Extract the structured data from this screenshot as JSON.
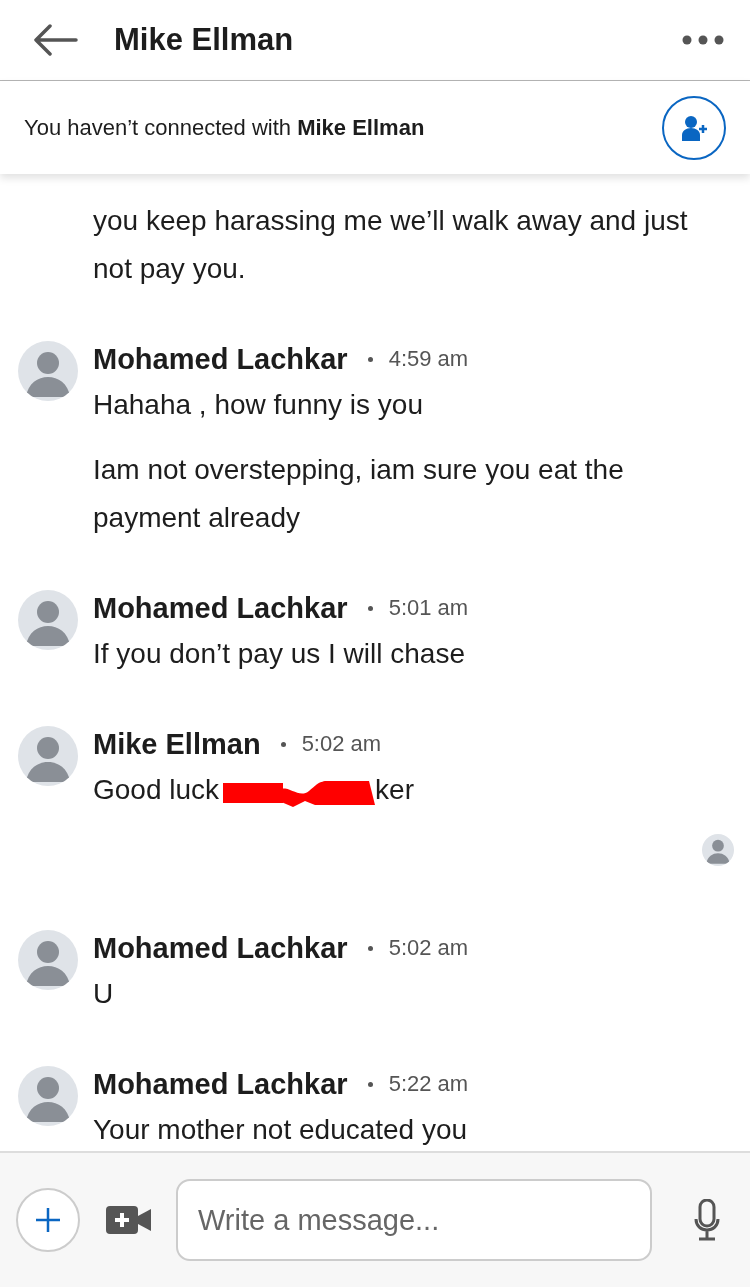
{
  "header": {
    "title": "Mike Ellman"
  },
  "connect_banner": {
    "text": "You haven’t connected with **Mike Ellman**"
  },
  "messages": [
    {
      "paragraphs": [
        [
          {
            "kind": "text",
            "text": "you keep harassing me we’ll walk away and just not pay you."
          }
        ]
      ]
    },
    {
      "sender": "Mohamed Lachkar",
      "time": "4:59 am",
      "paragraphs": [
        [
          {
            "kind": "text",
            "text": "Hahaha , how funny is you"
          }
        ],
        [
          {
            "kind": "text",
            "text": "Iam not overstepping, iam sure you eat the payment already"
          }
        ]
      ]
    },
    {
      "sender": "Mohamed Lachkar",
      "time": "5:01 am",
      "paragraphs": [
        [
          {
            "kind": "text",
            "text": "If you don’t  pay us I will chase"
          }
        ]
      ]
    },
    {
      "sender": "Mike Ellman",
      "time": "5:02 am",
      "seen": true,
      "paragraphs": [
        [
          {
            "kind": "text",
            "text": "Good luck"
          },
          {
            "kind": "redaction"
          },
          {
            "kind": "text",
            "text": "ker"
          }
        ]
      ]
    },
    {
      "sender": "Mohamed Lachkar",
      "time": "5:02 am",
      "paragraphs": [
        [
          {
            "kind": "text",
            "text": "U"
          }
        ]
      ]
    },
    {
      "sender": "Mohamed Lachkar",
      "time": "5:22 am",
      "paragraphs": [
        [
          {
            "kind": "text",
            "text": "Your mother not educated you"
          }
        ]
      ]
    }
  ],
  "composer": {
    "placeholder": "Write a message..."
  }
}
